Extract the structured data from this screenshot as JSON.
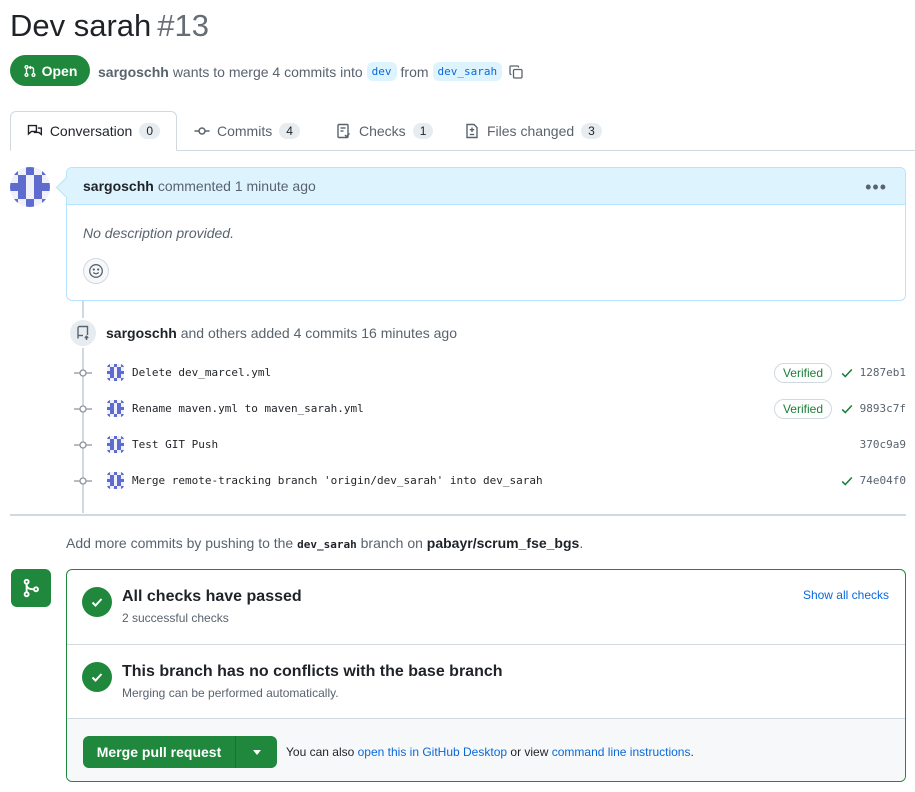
{
  "pr": {
    "title": "Dev sarah",
    "number": "#13",
    "state": "Open",
    "author": "sargoschh",
    "action_text": "wants to merge 4 commits into",
    "base_branch": "dev",
    "from_text": "from",
    "head_branch": "dev_sarah"
  },
  "tabs": [
    {
      "label": "Conversation",
      "count": "0"
    },
    {
      "label": "Commits",
      "count": "4"
    },
    {
      "label": "Checks",
      "count": "1"
    },
    {
      "label": "Files changed",
      "count": "3"
    }
  ],
  "comment": {
    "author": "sargoschh",
    "action": "commented 1 minute ago",
    "body": "No description provided."
  },
  "commits_event": {
    "author": "sargoschh",
    "text": "and others added 4 commits 16 minutes ago"
  },
  "commits": [
    {
      "message": "Delete dev_marcel.yml",
      "verified": "Verified",
      "sha": "1287eb1"
    },
    {
      "message": "Rename maven.yml to maven_sarah.yml",
      "verified": "Verified",
      "sha": "9893c7f"
    },
    {
      "message": "Test GIT Push",
      "verified": "",
      "sha": "370c9a9"
    },
    {
      "message": "Merge remote-tracking branch 'origin/dev_sarah' into dev_sarah",
      "verified": "",
      "sha": "74e04f0"
    }
  ],
  "add_more": {
    "prefix": "Add more commits by pushing to the",
    "branch": "dev_sarah",
    "middle": "branch on",
    "repo": "pabayr/scrum_fse_bgs",
    "suffix": "."
  },
  "merge": {
    "checks_title": "All checks have passed",
    "checks_sub": "2 successful checks",
    "show_all": "Show all checks",
    "conflicts_title": "This branch has no conflicts with the base branch",
    "conflicts_sub": "Merging can be performed automatically.",
    "button_label": "Merge pull request",
    "footer_prefix": "You can also",
    "footer_link1": "open this in GitHub Desktop",
    "footer_middle": "or view",
    "footer_link2": "command line instructions",
    "footer_suffix": "."
  },
  "colors": {
    "green": "#1f883d",
    "blue_link": "#0969da",
    "comment_header": "#ddf4ff"
  }
}
